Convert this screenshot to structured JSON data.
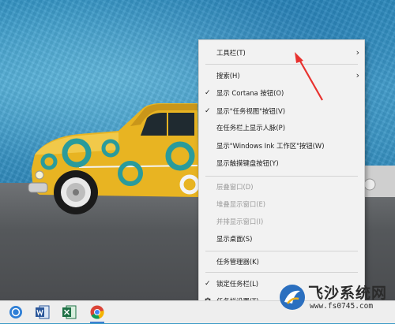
{
  "context_menu": {
    "items": [
      {
        "label": "工具栏(T)",
        "arrow": "›"
      },
      {
        "label": "搜索(H)",
        "arrow": "›"
      },
      {
        "label": "显示 Cortana 按钮(O)",
        "check": "✓"
      },
      {
        "label": "显示\"任务视图\"按钮(V)",
        "check": "✓"
      },
      {
        "label": "在任务栏上显示人脉(P)"
      },
      {
        "label": "显示\"Windows Ink 工作区\"按钮(W)"
      },
      {
        "label": "显示触摸键盘按钮(Y)"
      },
      {
        "label": "层叠窗口(D)",
        "disabled": true
      },
      {
        "label": "堆叠显示窗口(E)",
        "disabled": true
      },
      {
        "label": "并排显示窗口(I)",
        "disabled": true
      },
      {
        "label": "显示桌面(S)"
      },
      {
        "label": "任务管理器(K)"
      },
      {
        "label": "锁定任务栏(L)",
        "check": "✓"
      },
      {
        "label": "任务栏设置(T)",
        "icon": "gear-icon"
      }
    ]
  },
  "taskbar": {
    "icons": [
      "cortana-icon",
      "word-icon",
      "excel-icon",
      "chrome-icon"
    ]
  },
  "watermark": {
    "title": "飞沙系统网",
    "url": "www.fs0745.com"
  },
  "colors": {
    "annotation_arrow": "#e8322f",
    "car_yellow": "#e8b422",
    "accent_teal": "#2a9b9b"
  }
}
